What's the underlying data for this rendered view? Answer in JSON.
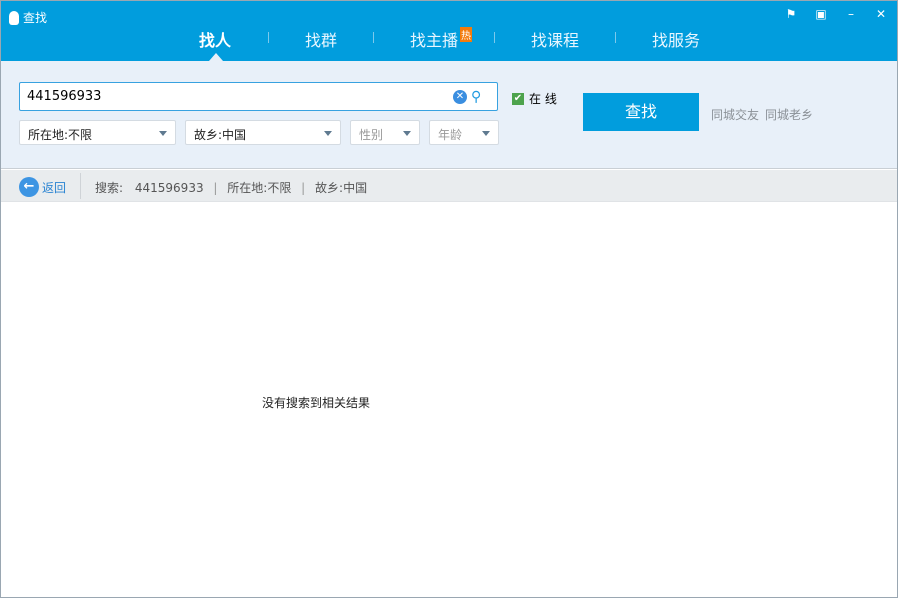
{
  "window": {
    "title": "查找",
    "controls": [
      "反馈",
      "锁定",
      "最小化",
      "关闭"
    ],
    "control_glyphs": [
      "⚑",
      "▣",
      "–",
      "✕"
    ]
  },
  "tabs": [
    {
      "label": "找人",
      "active": true
    },
    {
      "label": "找群"
    },
    {
      "label": "找主播",
      "badge": "热"
    },
    {
      "label": "找课程"
    },
    {
      "label": "找服务"
    }
  ],
  "search": {
    "value": "441596933",
    "online_label": "在 线",
    "online_checked": true,
    "location": "所在地:不限",
    "hometown": "故乡:中国",
    "gender_placeholder": "性别",
    "age_placeholder": "年龄",
    "button": "查找",
    "links": [
      "同城交友",
      "同城老乡"
    ]
  },
  "results_bar": {
    "back": "返回",
    "query_label": "搜索:",
    "query": "441596933",
    "location": "所在地:不限",
    "hometown": "故乡:中国",
    "separator": "|"
  },
  "empty_message": "没有搜索到相关结果"
}
